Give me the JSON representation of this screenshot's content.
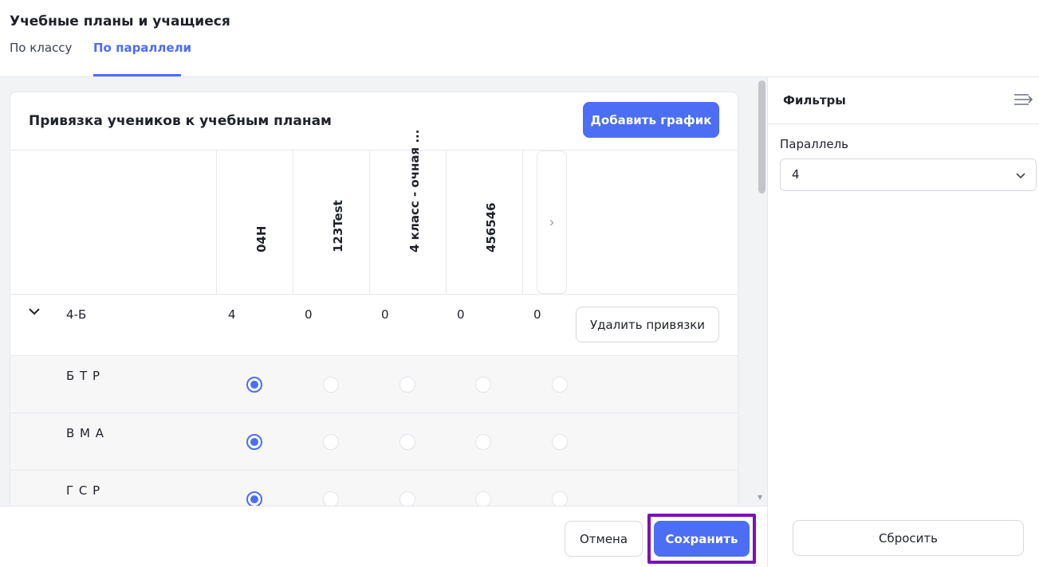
{
  "header": {
    "title": "Учебные планы и учащиеся",
    "tabs": [
      {
        "label": "По классу",
        "active": false
      },
      {
        "label": "По параллели",
        "active": true
      }
    ]
  },
  "card": {
    "title": "Привязка учеников к учебным планам",
    "add_button": "Добавить график",
    "columns": [
      "04Н",
      "123Test",
      "4 класс - очная ...",
      "456546",
      ""
    ],
    "next_icon": "chevron-right-icon",
    "group": {
      "label": "4-Б",
      "counts": [
        "4",
        "0",
        "0",
        "0",
        "0"
      ],
      "delete_button": "Удалить привязки"
    },
    "students": [
      {
        "name": "Б Т Р",
        "selected_column": 0
      },
      {
        "name": "В М А",
        "selected_column": 0
      },
      {
        "name": "Г С Р",
        "selected_column": 0
      }
    ]
  },
  "footer": {
    "cancel_label": "Отмена",
    "save_label": "Сохранить"
  },
  "filters": {
    "title": "Фильтры",
    "collapse_icon": "collapse-panel-icon",
    "parallel_label": "Параллель",
    "parallel_value": "4",
    "reset_label": "Сбросить"
  },
  "colors": {
    "accent": "#4b6ef5",
    "highlight": "#7a12b8"
  }
}
